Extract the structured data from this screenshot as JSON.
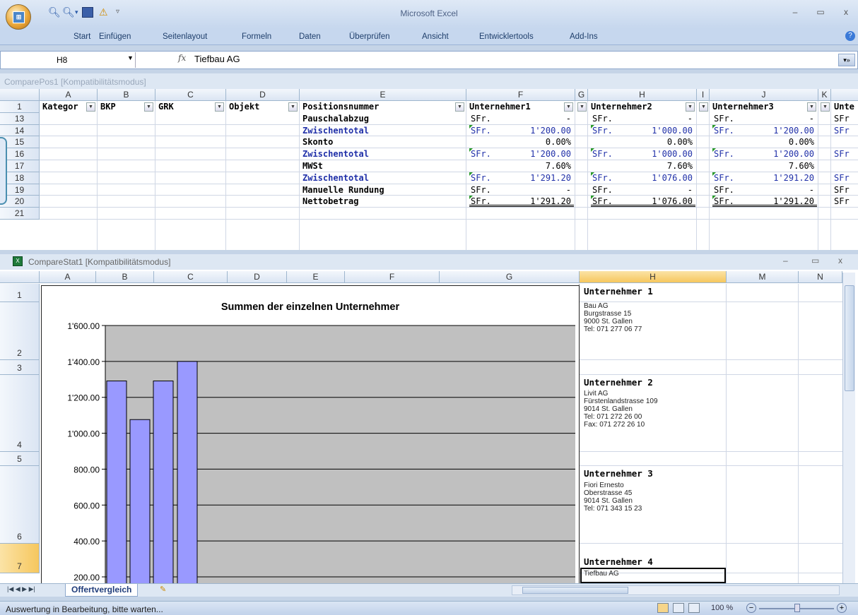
{
  "app": {
    "title": "Microsoft Excel"
  },
  "ribbon_tabs": [
    "Start",
    "Einfügen",
    "Seitenlayout",
    "Formeln",
    "Daten",
    "Überprüfen",
    "Ansicht",
    "Entwicklertools",
    "Add-Ins"
  ],
  "formula_bar": {
    "name_box": "H8",
    "fx": "fx",
    "value": "Tiefbau AG"
  },
  "window1": {
    "title": "ComparePos1  [Kompatibilitätsmodus]",
    "columns": [
      "A",
      "B",
      "C",
      "D",
      "E",
      "F",
      "G",
      "H",
      "I",
      "J",
      "K"
    ],
    "header_row": {
      "row": "1",
      "A": "Kategor",
      "B": "BKP",
      "C": "GRK",
      "D": "Objekt",
      "E": "Positionsnummer",
      "F": "Unternehmer1",
      "H": "Unternehmer2",
      "J": "Unternehmer3",
      "L": "Unte"
    },
    "rows": [
      {
        "num": "13",
        "label": "Pauschalabzug",
        "blue": false,
        "u1c": "SFr.",
        "u1": "-",
        "u2c": "SFr.",
        "u2": "-",
        "u3c": "SFr.",
        "u3": "-",
        "u4c": "SFr"
      },
      {
        "num": "14",
        "label": "Zwischentotal",
        "blue": true,
        "u1c": "SFr.",
        "u1": "1'200.00",
        "u2c": "SFr.",
        "u2": "1'000.00",
        "u3c": "SFr.",
        "u3": "1'200.00",
        "u4c": "SFr"
      },
      {
        "num": "15",
        "label": "Skonto",
        "blue": false,
        "u1c": "",
        "u1": "0.00%",
        "u2c": "",
        "u2": "0.00%",
        "u3c": "",
        "u3": "0.00%",
        "u4c": ""
      },
      {
        "num": "16",
        "label": "Zwischentotal",
        "blue": true,
        "u1c": "SFr.",
        "u1": "1'200.00",
        "u2c": "SFr.",
        "u2": "1'000.00",
        "u3c": "SFr.",
        "u3": "1'200.00",
        "u4c": "SFr"
      },
      {
        "num": "17",
        "label": "MWSt",
        "blue": false,
        "u1c": "",
        "u1": "7.60%",
        "u2c": "",
        "u2": "7.60%",
        "u3c": "",
        "u3": "7.60%",
        "u4c": ""
      },
      {
        "num": "18",
        "label": "Zwischentotal",
        "blue": true,
        "u1c": "SFr.",
        "u1": "1'291.20",
        "u2c": "SFr.",
        "u2": "1'076.00",
        "u3c": "SFr.",
        "u3": "1'291.20",
        "u4c": "SFr"
      },
      {
        "num": "19",
        "label": "Manuelle Rundung",
        "blue": false,
        "u1c": "SFr.",
        "u1": "-",
        "u2c": "SFr.",
        "u2": "-",
        "u3c": "SFr.",
        "u3": "-",
        "u4c": "SFr"
      },
      {
        "num": "20",
        "label": "Nettobetrag",
        "blue": false,
        "u1c": "SFr.",
        "u1": "1'291.20",
        "u2c": "SFr.",
        "u2": "1'076.00",
        "u3c": "SFr.",
        "u3": "1'291.20",
        "u4c": "SFr"
      },
      {
        "num": "21",
        "label": "",
        "blue": false,
        "u1c": "",
        "u1": "",
        "u2c": "",
        "u2": "",
        "u3c": "",
        "u3": "",
        "u4c": ""
      }
    ]
  },
  "window2": {
    "title": "CompareStat1  [Kompatibilitätsmodus]",
    "columns": [
      "A",
      "B",
      "C",
      "D",
      "E",
      "F",
      "G",
      "H",
      "M",
      "N"
    ],
    "row_numbers": [
      "1",
      "2",
      "3",
      "4",
      "5",
      "6",
      "7"
    ],
    "contractors": [
      {
        "heading": "Unternehmer 1",
        "lines": [
          "Bau AG",
          "Burgstrasse 15",
          "9000 St. Gallen",
          "Tel: 071 277 06 77"
        ]
      },
      {
        "heading": "Unternehmer 2",
        "lines": [
          "Livit AG",
          "Fürstenlandstrasse 109",
          "9014 St. Gallen",
          "Tel: 071 272 26 00",
          "Fax: 071 272 26 10"
        ]
      },
      {
        "heading": "Unternehmer 3",
        "lines": [
          "Fiori Ernesto",
          "Oberstrasse 45",
          "9014 St. Gallen",
          "Tel: 071 343 15 23"
        ]
      },
      {
        "heading": "Unternehmer 4",
        "lines": [
          "Tiefbau AG"
        ]
      }
    ]
  },
  "chart_data": {
    "type": "bar",
    "title": "Summen der einzelnen Unternehmer",
    "categories": [
      "",
      "",
      "",
      ""
    ],
    "values": [
      1291.2,
      1076.0,
      1291.2,
      1400.0
    ],
    "ylim": [
      200,
      1600
    ],
    "y_ticks": [
      "1'600.00",
      "1'400.00",
      "1'200.00",
      "1'000.00",
      "800.00",
      "600.00",
      "400.00",
      "200.00"
    ],
    "bar_color": "#9999ff",
    "plot_bg": "#c0c0c0",
    "grid": true
  },
  "sheet_tab": "Offertvergleich",
  "status": {
    "text": "Auswertung in Bearbeitung, bitte warten...",
    "zoom": "100 %"
  }
}
